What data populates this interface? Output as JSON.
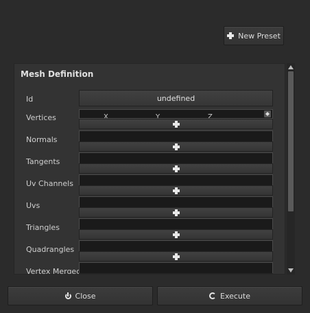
{
  "toolbar": {
    "new_preset_label": "New Preset",
    "new_preset_icon": "plus-icon"
  },
  "panel": {
    "title": "Mesh Definition",
    "id_label": "Id",
    "id_value": "undefined",
    "vertices_label": "Vertices",
    "vertex_axes": [
      "X",
      "Y",
      "Z"
    ],
    "fields": [
      {
        "label": "Normals"
      },
      {
        "label": "Tangents"
      },
      {
        "label": "Uv Channels"
      },
      {
        "label": "Uvs"
      },
      {
        "label": "Triangles"
      },
      {
        "label": "Quadrangles"
      },
      {
        "label": "Vertex Merged"
      }
    ]
  },
  "footer": {
    "close_label": "Close",
    "close_icon": "power-icon",
    "execute_label": "Execute",
    "execute_icon": "refresh-icon"
  }
}
